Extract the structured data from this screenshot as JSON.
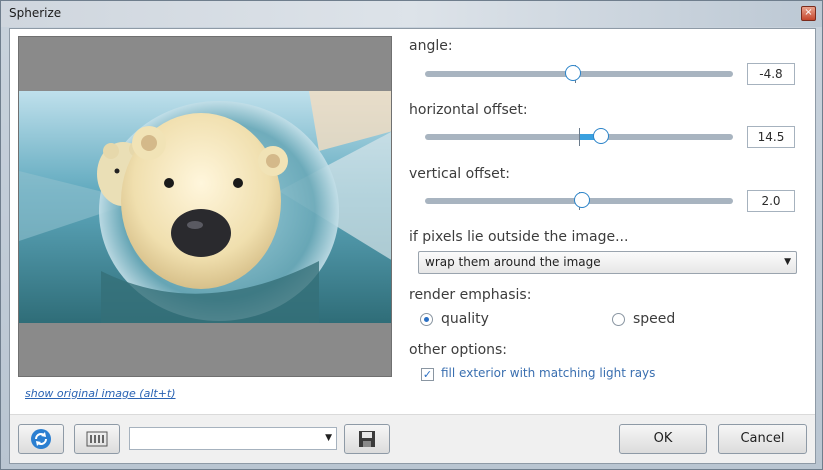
{
  "window": {
    "title": "Spherize",
    "close_glyph": "×"
  },
  "preview": {
    "show_original_label": "show original image (alt+t)"
  },
  "controls": {
    "angle": {
      "label": "angle:",
      "value": "-4.8",
      "fraction": 0.48
    },
    "horizontal_offset": {
      "label": "horizontal offset:",
      "value": "14.5",
      "fraction": 0.57
    },
    "vertical_offset": {
      "label": "vertical offset:",
      "value": "2.0",
      "fraction": 0.51
    },
    "outside": {
      "label": "if pixels lie outside the image...",
      "selected": "wrap them around the image"
    },
    "emphasis": {
      "label": "render emphasis:",
      "options": [
        {
          "label": "quality",
          "checked": true
        },
        {
          "label": "speed",
          "checked": false
        }
      ]
    },
    "other": {
      "label": "other options:",
      "fill_exterior": {
        "label": "fill exterior with matching light rays",
        "checked": true
      }
    }
  },
  "footer": {
    "preset_value": "",
    "ok_label": "OK",
    "cancel_label": "Cancel",
    "icons": [
      "refresh-icon",
      "randomize-icon",
      "save-preset-icon"
    ]
  },
  "colors": {
    "accent": "#3aa0df",
    "link": "#2a63b3"
  }
}
